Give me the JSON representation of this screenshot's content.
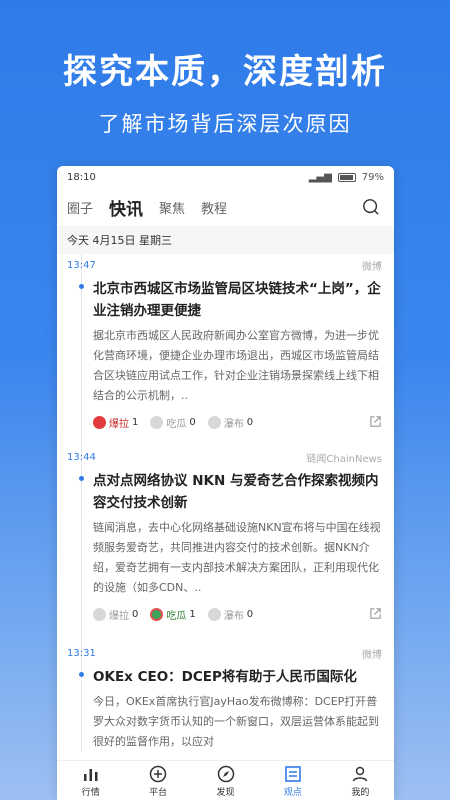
{
  "promo": {
    "title": "探究本质，深度剖析",
    "subtitle": "了解市场背后深层次原因"
  },
  "statusbar": {
    "time": "18:10",
    "battery": "79%"
  },
  "nav": {
    "tabs": [
      {
        "label": "圈子"
      },
      {
        "label": "快讯"
      },
      {
        "label": "聚焦"
      },
      {
        "label": "教程"
      }
    ],
    "active_index": 1,
    "search_icon": "search-icon"
  },
  "date_row": "今天 4月15日 星期三",
  "feed": [
    {
      "time": "13:47",
      "source": "微博",
      "title": "北京市西城区市场监管局区块链技术“上岗”，企业注销办理更便捷",
      "body": "据北京市西城区人民政府新闻办公室官方微博，为进一步优化营商环境，便捷企业办理市场退出，西城区市场监管局结合区块链应用试点工作，针对企业注销场景探索线上线下相结合的公示机制，..",
      "actions": [
        {
          "label": "爆拉",
          "count": "1"
        },
        {
          "label": "吃瓜",
          "count": "0"
        },
        {
          "label": "瀑布",
          "count": "0"
        }
      ]
    },
    {
      "time": "13:44",
      "source": "链闻ChainNews",
      "title": "点对点网络协议 NKN 与爱奇艺合作探索视频内容交付技术创新",
      "body": "链闻消息，去中心化网络基础设施NKN宣布将与中国在线视频服务爱奇艺，共同推进内容交付的技术创新。据NKN介绍，爱奇艺拥有一支内部技术解决方案团队，正利用现代化的设施（如多CDN、..",
      "actions": [
        {
          "label": "爆拉",
          "count": "0"
        },
        {
          "label": "吃瓜",
          "count": "1"
        },
        {
          "label": "瀑布",
          "count": "0"
        }
      ]
    },
    {
      "time": "13:31",
      "source": "微博",
      "title": "OKEx CEO：DCEP将有助于人民币国际化",
      "body": "今日，OKEx首席执行官JayHao发布微博称：DCEP打开普罗大众对数字货币认知的一个新窗口，双层运营体系能起到很好的监督作用，以应对"
    }
  ],
  "tabbar": [
    {
      "label": "行情",
      "icon": "bar-chart-icon"
    },
    {
      "label": "平台",
      "icon": "platform-icon"
    },
    {
      "label": "发现",
      "icon": "compass-icon"
    },
    {
      "label": "观点",
      "icon": "article-icon"
    },
    {
      "label": "我的",
      "icon": "user-icon"
    }
  ],
  "colors": {
    "accent": "#2f7be8",
    "hot_red": "#c62828",
    "hot_green": "#2e7d32"
  }
}
